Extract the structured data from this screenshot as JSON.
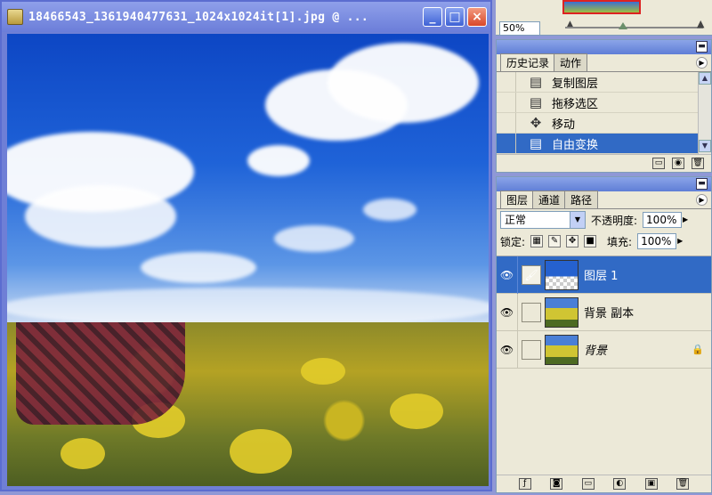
{
  "document": {
    "title": "18466543_1361940477631_1024x1024it[1].jpg @ ...",
    "minimize_glyph": "_",
    "maximize_glyph": "□",
    "close_glyph": "×"
  },
  "navigator": {
    "zoom_value": "50%"
  },
  "history_panel": {
    "tabs": [
      {
        "label": "历史记录",
        "active": true
      },
      {
        "label": "动作",
        "active": false
      }
    ],
    "items": [
      {
        "label": "复制图层",
        "icon": "history-state-icon",
        "selected": false
      },
      {
        "label": "拖移选区",
        "icon": "history-state-icon",
        "selected": false
      },
      {
        "label": "移动",
        "icon": "move-tool-icon",
        "selected": false
      },
      {
        "label": "自由变换",
        "icon": "history-state-icon",
        "selected": true
      }
    ]
  },
  "layers_panel": {
    "tabs": [
      {
        "label": "图层",
        "active": true
      },
      {
        "label": "通道",
        "active": false
      },
      {
        "label": "路径",
        "active": false
      }
    ],
    "blend_mode": "正常",
    "opacity_label": "不透明度:",
    "opacity_value": "100%",
    "lock_label": "锁定:",
    "fill_label": "填充:",
    "fill_value": "100%",
    "layers": [
      {
        "name": "图层 1",
        "selected": true,
        "thumb": "sky-with-transparency",
        "locked": false
      },
      {
        "name": "背景 副本",
        "selected": false,
        "thumb": "photo",
        "locked": false
      },
      {
        "name": "背景",
        "selected": false,
        "thumb": "photo",
        "locked": true
      }
    ]
  },
  "colors": {
    "selection": "#316ac5",
    "panel_bg": "#ece9d8",
    "titlebar": "#6b7ed9"
  }
}
